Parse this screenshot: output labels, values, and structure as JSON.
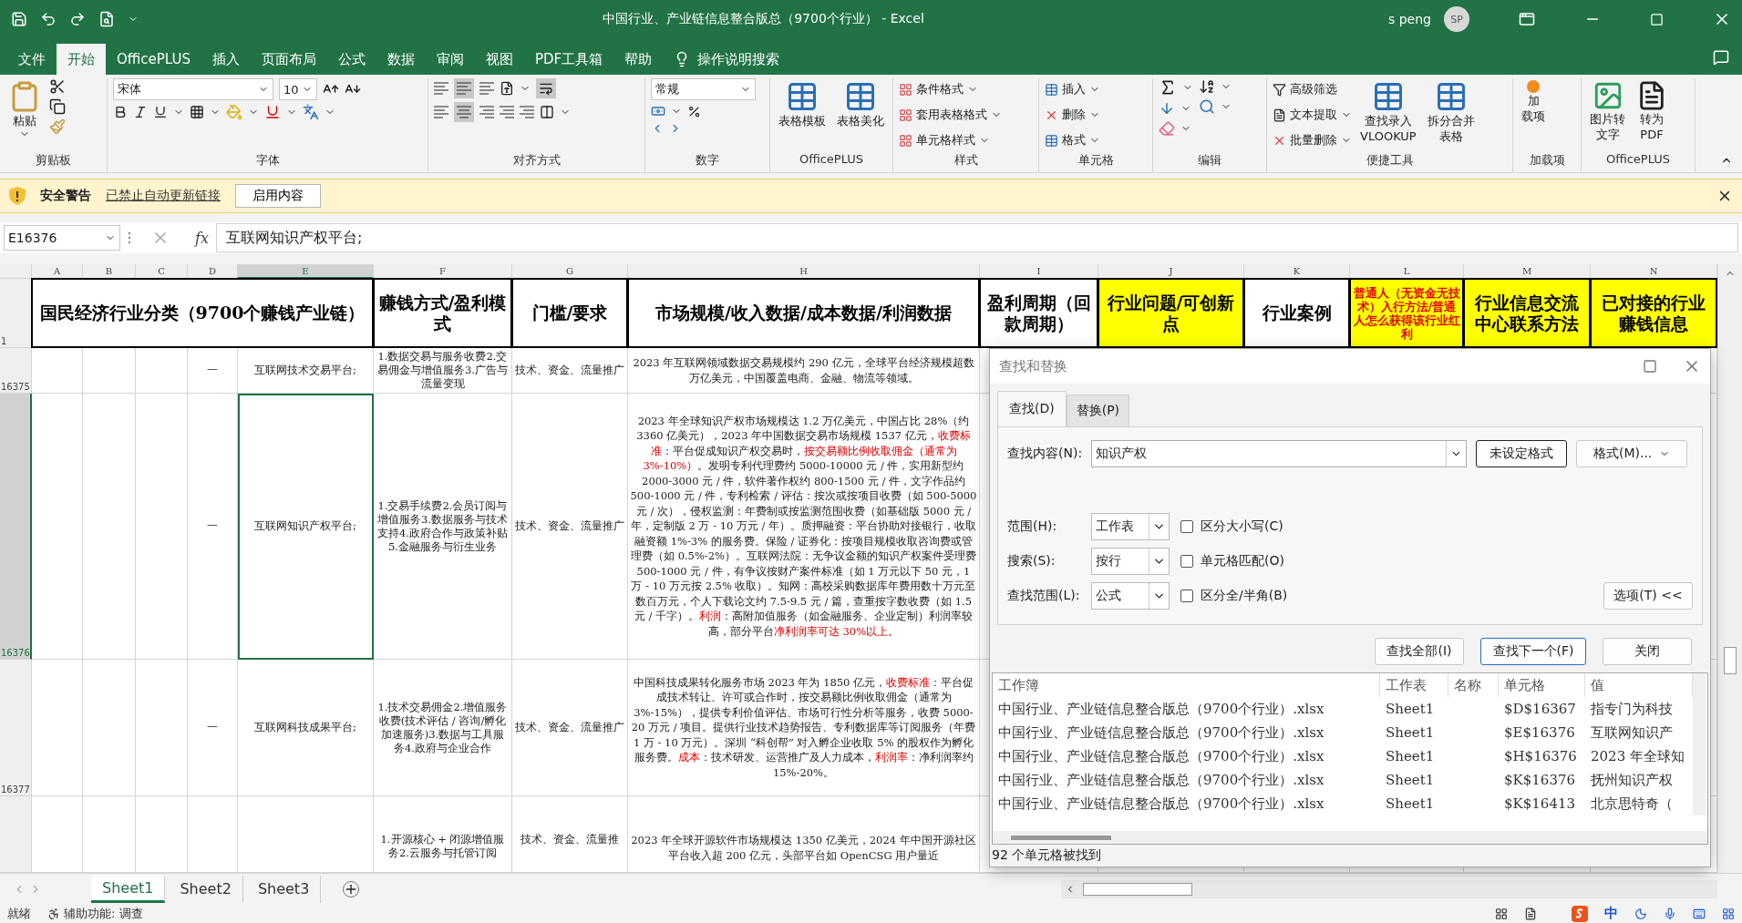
{
  "window": {
    "title": "中国行业、产业链信息整合版总（9700个行业） - Excel",
    "user": "s peng",
    "avatar": "SP"
  },
  "menu_tabs": [
    {
      "label": "文件",
      "selected": false
    },
    {
      "label": "开始",
      "selected": true
    },
    {
      "label": "OfficePLUS",
      "selected": false
    },
    {
      "label": "插入",
      "selected": false
    },
    {
      "label": "页面布局",
      "selected": false
    },
    {
      "label": "公式",
      "selected": false
    },
    {
      "label": "数据",
      "selected": false
    },
    {
      "label": "审阅",
      "selected": false
    },
    {
      "label": "视图",
      "selected": false
    },
    {
      "label": "PDF工具箱",
      "selected": false
    },
    {
      "label": "帮助",
      "selected": false
    }
  ],
  "tell_me": "操作说明搜索",
  "ribbon": {
    "groups": [
      {
        "label": "剪贴板",
        "items": [
          {
            "lines": [
              "粘贴"
            ]
          }
        ]
      },
      {
        "label": "字体",
        "items": [
          {
            "value": "宋体"
          },
          {
            "value": "10"
          }
        ]
      },
      {
        "label": "对齐方式"
      },
      {
        "label": "数字",
        "items": [
          {
            "value": "常规"
          }
        ]
      },
      {
        "label": "OfficePLUS",
        "items": [
          {
            "lines": [
              "表格模板"
            ]
          },
          {
            "lines": [
              "表格美化"
            ]
          }
        ]
      },
      {
        "label": "样式",
        "items": [
          {
            "lines": [
              "条件格式"
            ]
          },
          {
            "lines": [
              "套用表格格式"
            ]
          },
          {
            "lines": [
              "单元格样式"
            ]
          }
        ]
      },
      {
        "label": "单元格",
        "items": [
          {
            "lines": [
              "插入"
            ]
          },
          {
            "lines": [
              "删除"
            ]
          },
          {
            "lines": [
              "格式"
            ]
          }
        ]
      },
      {
        "label": "编辑"
      },
      {
        "label": "便捷工具",
        "items": [
          {
            "lines": [
              "高级筛选"
            ]
          },
          {
            "lines": [
              "文本提取"
            ]
          },
          {
            "lines": [
              "批量删除"
            ]
          },
          {
            "lines": [
              "查找录入",
              "VLOOKUP"
            ]
          },
          {
            "lines": [
              "拆分合并",
              "表格"
            ]
          }
        ]
      },
      {
        "label": "加载项",
        "items": [
          {
            "lines": [
              "加",
              "载项"
            ]
          }
        ]
      },
      {
        "label": "OfficePLUS",
        "items": [
          {
            "lines": [
              "图片转",
              "文字"
            ]
          },
          {
            "lines": [
              "转为",
              "PDF"
            ]
          }
        ]
      }
    ]
  },
  "security_bar": {
    "title": "安全警告",
    "message": "已禁止自动更新链接",
    "button": "启用内容"
  },
  "formula_bar": {
    "name_box": "E16376",
    "fx": "fx",
    "formula": "互联网知识产权平台;"
  },
  "sheet": {
    "columns": [
      {
        "label": "A",
        "selected": false
      },
      {
        "label": "B",
        "selected": false
      },
      {
        "label": "C",
        "selected": false
      },
      {
        "label": "D",
        "selected": false
      },
      {
        "label": "E",
        "selected": true
      },
      {
        "label": "F",
        "selected": false
      },
      {
        "label": "G",
        "selected": false
      },
      {
        "label": "H",
        "selected": false
      },
      {
        "label": "I",
        "selected": false
      },
      {
        "label": "J",
        "selected": false
      },
      {
        "label": "K",
        "selected": false
      },
      {
        "label": "L",
        "selected": false
      },
      {
        "label": "M",
        "selected": false
      },
      {
        "label": "N",
        "selected": false
      }
    ],
    "header_row": {
      "number": "1",
      "cells": [
        {
          "text": "国民经济行业分类（9700个赚钱产业链）",
          "highlighted": false,
          "red_text": false
        },
        {
          "text": "赚钱方式/盈利模式",
          "highlighted": false,
          "red_text": false
        },
        {
          "text": "门槛/要求",
          "highlighted": false,
          "red_text": false
        },
        {
          "text": "市场规模/收入数据/成本数据/利润数据",
          "highlighted": false,
          "red_text": false
        },
        {
          "text": "盈利周期（回款周期）",
          "highlighted": false,
          "red_text": false
        },
        {
          "text": "行业问题/可创新点",
          "highlighted": true,
          "red_text": false
        },
        {
          "text": "行业案例",
          "highlighted": false,
          "red_text": false
        },
        {
          "text": "普通人（无资金无技术）入行方法/普通人怎么获得该行业红利",
          "highlighted": true,
          "red_text": true
        },
        {
          "text": "行业信息交流中心联系方法",
          "highlighted": true,
          "red_text": false
        },
        {
          "text": "已对接的行业赚钱信息",
          "highlighted": true,
          "red_text": false
        }
      ]
    },
    "rows": [
      {
        "number": "16375",
        "selected": false,
        "d": "一",
        "e": "互联网技术交易平台;",
        "f": "1.数据交易与服务收费2.交易佣金与增值服务3.广告与流量变现",
        "g": "技术、资金、流量推广",
        "h": [
          {
            "text": "2023 年互联网领域数据交易规模约 290 亿元，全球平台经济规模超数万亿美元，中国覆盖电商、金融、物流等领域。",
            "red": false
          }
        ]
      },
      {
        "number": "16376",
        "selected": true,
        "d": "一",
        "e": "互联网知识产权平台;",
        "f": "1.交易手续费2.会员订阅与增值服务3.数据服务与技术支持4.政府合作与政策补贴5.金融服务与衍生业务",
        "g": "技术、资金、流量推广",
        "h": [
          {
            "text": "2023 年全球知识产权市场规模达 1.2 万亿美元，中国占比 28%（约 3360 亿美元），2023 年中国数据交易市场规模 1537 亿元，",
            "red": false
          },
          {
            "text": "收费标准",
            "red": true
          },
          {
            "text": "：平台促成知识产权交易时，",
            "red": false
          },
          {
            "text": "按交易额比例收取佣金（通常为 3%-10%）",
            "red": true
          },
          {
            "text": "。发明专利代理费约 5000-10000 元 / 件，实用新型约 2000-3000 元 / 件，软件著作权约 800-1500 元 / 件，文字作品约 500-1000 元 / 件，专利检索 / 评估：按次或按项目收费（如 500-5000 元 / 次），侵权监测：年费制或按监测范围收费（如基础版 5000 元 / 年，定制版 2 万 - 10 万元 / 年）。质押融资：平台协助对接银行，收取融资额 1%-3% 的服务费。保险 / 证券化：按项目规模收取咨询费或管理费（如 0.5%-2%）。互联网法院：无争议金额的知识产权案件受理费 500-1000 元 / 件，有争议按财产案件标准（如 1 万元以下 50 元，1 万 - 10 万元按 2.5% 收取）。知网：高校采购数据库年费用数十万元至数百万元，个人下载论文约 7.5-9.5 元 / 篇，查重按字数收费（如 1.5 元 / 千字）。",
            "red": false
          },
          {
            "text": "利润",
            "red": true
          },
          {
            "text": "：高附加值服务（如金融服务、企业定制）利润率较高，部分平台",
            "red": false
          },
          {
            "text": "净利润率可达 30%以上",
            "red": true
          },
          {
            "text": "。",
            "red": false
          }
        ]
      },
      {
        "number": "16377",
        "selected": false,
        "d": "一",
        "e": "互联网科技成果平台;",
        "f": "1.技术交易佣金2.增值服务收费(技术评估 / 咨询/孵化加速服务)3.数据与工具服务4.政府与企业合作",
        "g": "技术、资金、流量推广",
        "h": [
          {
            "text": "中国科技成果转化服务市场 2023 年为 1850 亿元，",
            "red": false
          },
          {
            "text": "收费标准",
            "red": true
          },
          {
            "text": "：平台促成技术转让、许可或合作时，按交易额比例收取佣金（通常为 3%-15%），提供专利价值评估、市场可行性分析等服务，收费 5000-20 万元 / 项目。提供行业技术趋势报告、专利数据库等订阅服务（年费 1 万 - 10 万元）。深圳 “科创帮” 对入孵企业收取 5% 的股权作为孵化服务费。",
            "red": false
          },
          {
            "text": "成本",
            "red": true
          },
          {
            "text": "：技术研发、运营推广及人力成本，",
            "red": false
          },
          {
            "text": "利润率",
            "red": true
          },
          {
            "text": "：净利润率约 15%-20%。",
            "red": false
          }
        ]
      },
      {
        "selected": false,
        "f": "1.开源核心 + 闭源增值服务2.云服务与托管订阅",
        "g": "技术、资金、流量推",
        "h": [
          {
            "text": "2023 年全球开源软件市场规模达 1350 亿美元，2024 年中国开源社区平台收入超 200 亿元，头部平台如 OpenCSG 用户量近",
            "red": false
          }
        ]
      }
    ]
  },
  "sheet_tabs": [
    {
      "label": "Sheet1",
      "selected": true
    },
    {
      "label": "Sheet2",
      "selected": false
    },
    {
      "label": "Sheet3",
      "selected": false
    }
  ],
  "status_bar": {
    "ready": "就绪",
    "accessibility": "辅助功能: 调查",
    "ime": "中"
  },
  "dialog": {
    "title": "查找和替换",
    "tabs": [
      {
        "label": "查找(D)",
        "selected": true
      },
      {
        "label": "替换(P)",
        "selected": false
      }
    ],
    "find_label": "查找内容(N):",
    "find_value": "知识产权",
    "no_format": "未设定格式",
    "format_button": "格式(M)...",
    "selects": [
      {
        "label": "范围(H):",
        "value": "工作表"
      },
      {
        "label": "搜索(S):",
        "value": "按行"
      },
      {
        "label": "查找范围(L):",
        "value": "公式"
      }
    ],
    "checkboxes": [
      {
        "label": "区分大小写(C)",
        "checked": false
      },
      {
        "label": "单元格匹配(O)",
        "checked": false
      },
      {
        "label": "区分全/半角(B)",
        "checked": false
      }
    ],
    "options_button": "选项(T) <<",
    "buttons": [
      {
        "label": "查找全部(I)",
        "focused": false
      },
      {
        "label": "查找下一个(F)",
        "focused": true
      },
      {
        "label": "关闭",
        "focused": false
      }
    ],
    "result_columns": [
      "工作簿",
      "工作表",
      "名称",
      "单元格",
      "值"
    ],
    "results": [
      {
        "workbook": "中国行业、产业链信息整合版总（9700个行业）.xlsx",
        "sheet": "Sheet1",
        "cell": "$D$16367",
        "value": "指专门为科技"
      },
      {
        "workbook": "中国行业、产业链信息整合版总（9700个行业）.xlsx",
        "sheet": "Sheet1",
        "cell": "$E$16376",
        "value": "互联网知识产"
      },
      {
        "workbook": "中国行业、产业链信息整合版总（9700个行业）.xlsx",
        "sheet": "Sheet1",
        "cell": "$H$16376",
        "value": "2023 年全球知"
      },
      {
        "workbook": "中国行业、产业链信息整合版总（9700个行业）.xlsx",
        "sheet": "Sheet1",
        "cell": "$K$16376",
        "value": "抚州知识产权"
      },
      {
        "workbook": "中国行业、产业链信息整合版总（9700个行业）.xlsx",
        "sheet": "Sheet1",
        "cell": "$K$16413",
        "value": "北京思特奇（"
      }
    ],
    "found": "92 个单元格被找到"
  }
}
